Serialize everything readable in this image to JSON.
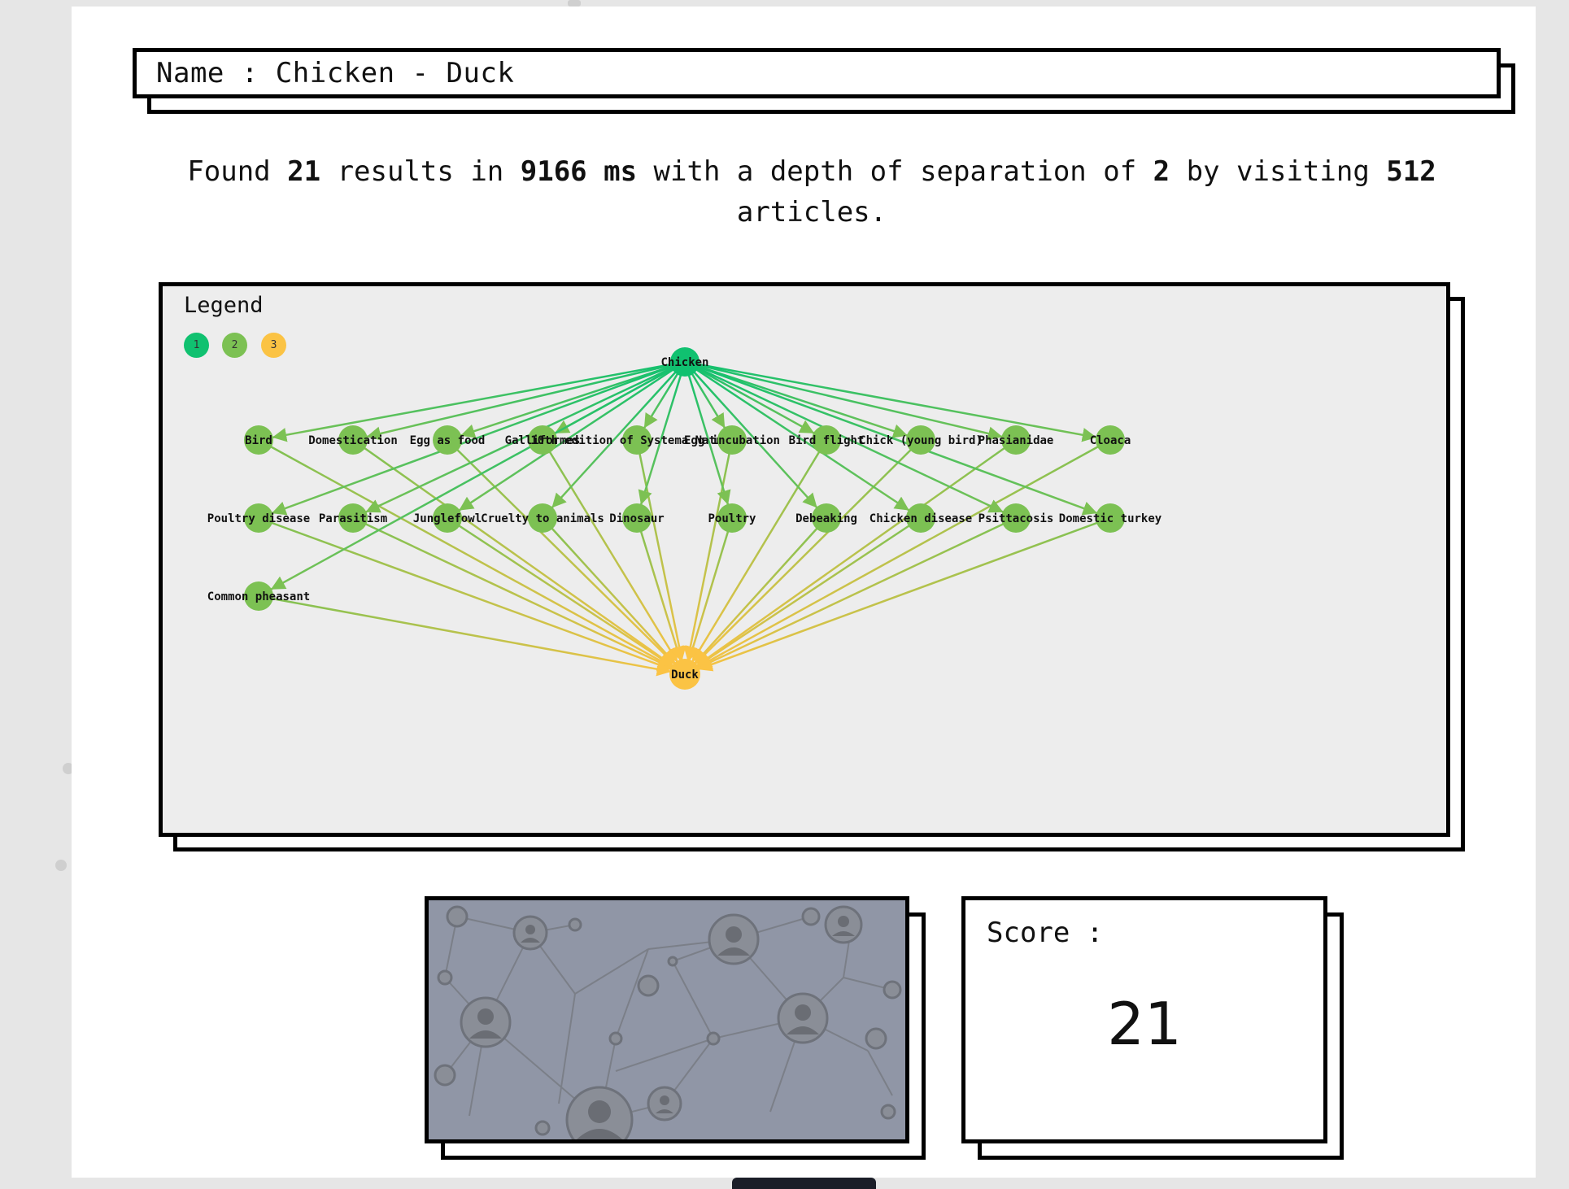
{
  "header": {
    "name_label": "Name : Chicken - Duck"
  },
  "results": {
    "prefix": "Found",
    "count": "21",
    "in_label": "results in",
    "time": "9166 ms",
    "depth_label": "with a depth of separation of",
    "depth": "2",
    "visiting_label": "by visiting",
    "articles_count": "512",
    "suffix": "articles."
  },
  "legend": {
    "title": "Legend",
    "items": [
      {
        "label": "1",
        "color": "#10c170"
      },
      {
        "label": "2",
        "color": "#7cc153"
      },
      {
        "label": "3",
        "color": "#fbc344"
      }
    ]
  },
  "graph": {
    "colors": {
      "level1": "#10c170",
      "level2": "#7cc153",
      "level3": "#fbc344"
    },
    "source": "Chicken",
    "target": "Duck",
    "intermediates": [
      "Bird",
      "Domestication",
      "Egg as food",
      "Galliformes",
      "10th edition of Systema Naturae",
      "Egg incubation",
      "Bird flight",
      "Chick (young bird)",
      "Phasianidae",
      "Cloaca",
      "Poultry disease",
      "Parasitism",
      "Junglefowl",
      "Cruelty to animals",
      "Dinosaur",
      "Poultry",
      "Debeaking",
      "Chicken disease",
      "Psittacosis",
      "Domestic turkey",
      "Common pheasant"
    ]
  },
  "score": {
    "label": "Score :",
    "value": "21"
  },
  "image": {
    "description_icon": "network-people-image"
  }
}
